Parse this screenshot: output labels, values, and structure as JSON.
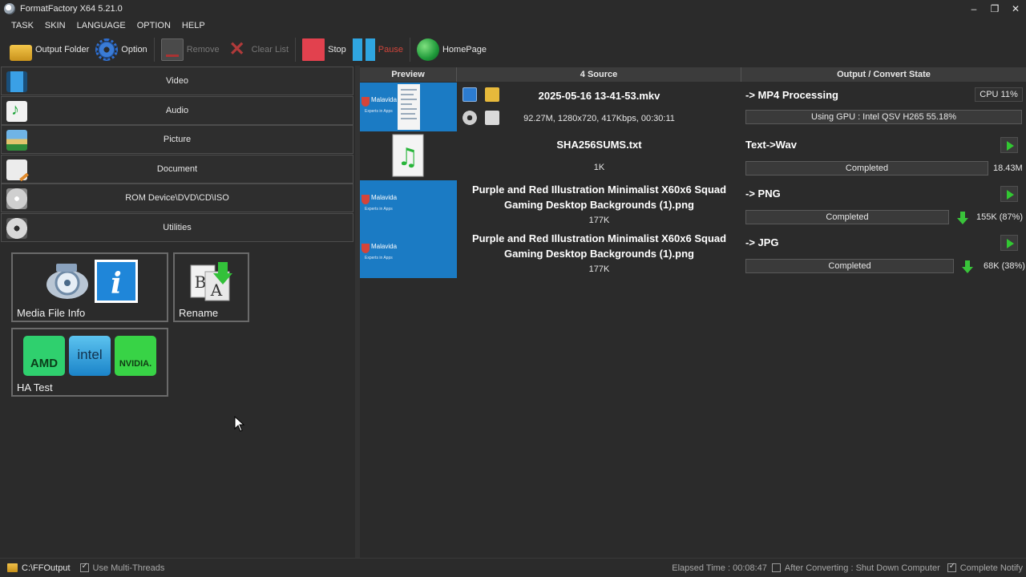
{
  "window": {
    "title": "FormatFactory X64 5.21.0",
    "minimize": "–",
    "restore": "❐",
    "close": "✕"
  },
  "menu": [
    "TASK",
    "SKIN",
    "LANGUAGE",
    "OPTION",
    "HELP"
  ],
  "toolbar": {
    "output_folder": "Output Folder",
    "option": "Option",
    "remove": "Remove",
    "clear_list": "Clear List",
    "stop": "Stop",
    "pause": "Pause",
    "homepage": "HomePage"
  },
  "categories": [
    {
      "label": "Video",
      "icon": "video-icon"
    },
    {
      "label": "Audio",
      "icon": "audio-icon"
    },
    {
      "label": "Picture",
      "icon": "picture-icon"
    },
    {
      "label": "Document",
      "icon": "document-icon"
    },
    {
      "label": "ROM Device\\DVD\\CD\\ISO",
      "icon": "disc-icon"
    },
    {
      "label": "Utilities",
      "icon": "utilities-icon"
    }
  ],
  "tools": [
    {
      "label": "Media File Info"
    },
    {
      "label": "Rename"
    },
    {
      "label": "HA Test",
      "badges": [
        "AMD",
        "intel",
        "NVIDIA."
      ]
    }
  ],
  "task_header": {
    "preview": "Preview",
    "source": "4 Source",
    "output": "Output / Convert State"
  },
  "thumb_text": {
    "brand": "Malavida",
    "tagline": "Experts in Apps"
  },
  "tasks": [
    {
      "name": "2025-05-16 13-41-53.mkv",
      "meta": "92.27M, 1280x720, 417Kbps, 00:30:11",
      "output": "-> MP4 Processing",
      "state": "Using GPU : Intel QSV H265 55.18%",
      "cpu": "CPU 11%",
      "progress": 0.5518
    },
    {
      "name": "SHA256SUMS.txt",
      "meta": "1K",
      "output": "Text->Wav",
      "state": "Completed",
      "size": "18.43M"
    },
    {
      "name": "Purple and Red Illustration Minimalist X60x6 Squad Gaming Desktop Backgrounds (1).png",
      "meta": "177K",
      "output": "-> PNG",
      "state": "Completed",
      "size": "155K (87%)"
    },
    {
      "name": "Purple and Red Illustration Minimalist X60x6 Squad Gaming Desktop Backgrounds (1).png",
      "meta": "177K",
      "output": "-> JPG",
      "state": "Completed",
      "size": "68K (38%)"
    }
  ],
  "status": {
    "output_path": "C:\\FFOutput",
    "multi_threads": "Use Multi-Threads",
    "elapsed": "Elapsed Time : 00:08:47",
    "after_converting": "After Converting : Shut Down Computer",
    "complete_notify": "Complete Notify"
  },
  "colors": {
    "background": "#2b2b2b",
    "thumb_blue": "#1b7bc4",
    "accent_green": "#32c832",
    "stop_red": "#e2414e",
    "pause_blue": "#2fa5e0"
  }
}
